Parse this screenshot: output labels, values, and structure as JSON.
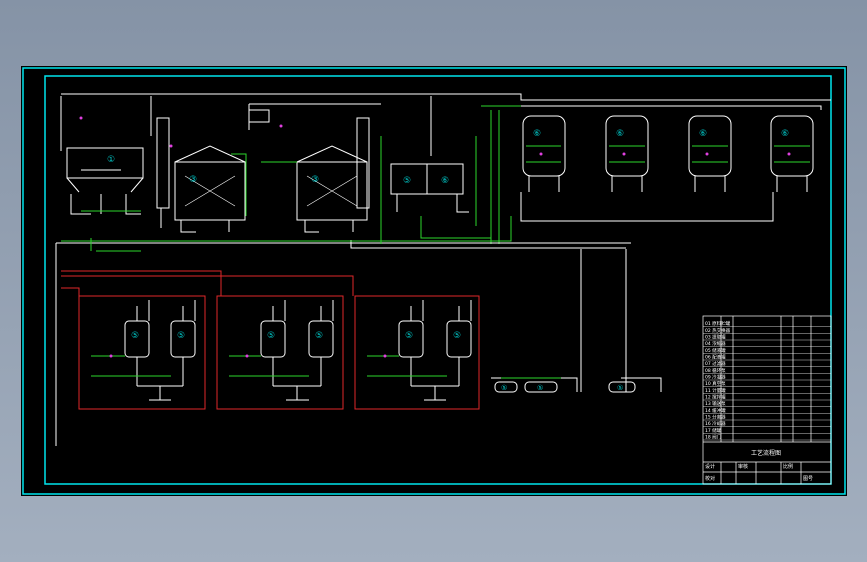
{
  "viewer": {
    "background_color": "#8b9aab",
    "canvas_color": "#000000"
  },
  "drawing": {
    "colors": {
      "border": "#00e5ee",
      "process": "#ffffff",
      "pipe_green": "#2bd62b",
      "pipe_red": "#e0282a",
      "equipment_tag": "#00c8c8",
      "valve_magenta": "#e040e0",
      "title_block": "#ffffff"
    },
    "equipment_tags": {
      "hopper": "①",
      "extractor_1": "③",
      "extractor_2": "③",
      "tank_a": "⑤",
      "tank_b": "⑥",
      "tank_row": [
        "⑥",
        "⑥",
        "⑥",
        "⑥"
      ],
      "reactors": [
        "⑤",
        "⑤",
        "⑤",
        "⑤",
        "⑤",
        "⑤"
      ],
      "pumps_left": [
        "⑤",
        "⑤"
      ],
      "pump_right": "⑤"
    },
    "title_block": {
      "parts_rows": [
        "01 原料贮罐",
        "02 热交换器",
        "03 提取罐",
        "04 浓缩器",
        "05 储液罐",
        "06 配液罐",
        "07 过滤器",
        "08 循环泵",
        "09 冷凝器",
        "10 真空泵",
        "11 计量罐",
        "12 搅拌罐",
        "13 输送泵",
        "14 缓冲罐",
        "15 分离器",
        "16 冷却器",
        "17 储罐",
        "18 阀门"
      ],
      "caption": "工艺流程图",
      "footer_cells": [
        "设计",
        "校对",
        "审核",
        "比例",
        "图号"
      ]
    }
  }
}
